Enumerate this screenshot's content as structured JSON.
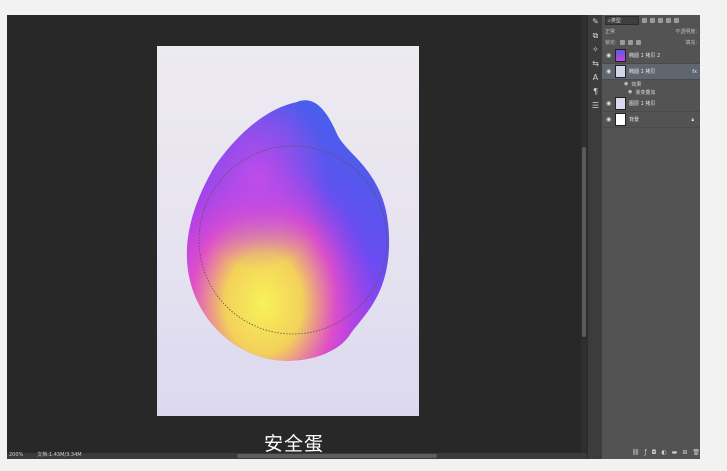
{
  "caption": "安全蛋",
  "status": {
    "zoom": "200%",
    "doc_info": "文档:1.43M/3.34M"
  },
  "layers_panel": {
    "filter_kind": "类型",
    "blend_mode": "正常",
    "opacity_label": "不透明度:",
    "lock_label": "锁定:",
    "fill_label": "填充:",
    "layers": [
      {
        "name": "椭圆 1 拷贝 2",
        "visible": true,
        "selected": false,
        "thumb_color": "#7b4be8"
      },
      {
        "name": "椭圆 1 拷贝",
        "visible": true,
        "selected": true,
        "thumb_color": "#cfd6e6",
        "fx": "fx"
      },
      {
        "name": "图层 1 拷贝",
        "visible": true,
        "selected": false,
        "thumb_color": "#dcd8ef"
      },
      {
        "name": "背景",
        "visible": true,
        "selected": false,
        "thumb_color": "#ffffff"
      }
    ],
    "effects_label": "效果",
    "effect_item": "渐变叠加"
  },
  "colors": {
    "canvas_bg": "#282828",
    "panel_bg": "#535353",
    "selected_layer": "#5f6670",
    "blob_yellow": "#f5ef5a",
    "blob_purple": "#9a3cf0",
    "blob_blue": "#4c5ce8"
  }
}
